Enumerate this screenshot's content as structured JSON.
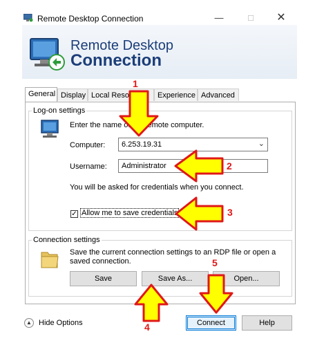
{
  "window": {
    "title": "Remote Desktop Connection"
  },
  "banner": {
    "line1": "Remote Desktop",
    "line2": "Connection"
  },
  "tabs": [
    {
      "label": "General"
    },
    {
      "label": "Display"
    },
    {
      "label": "Local Resources"
    },
    {
      "label": "Experience"
    },
    {
      "label": "Advanced"
    }
  ],
  "logon": {
    "group_label": "Log-on settings",
    "instruction": "Enter the name of the remote computer.",
    "computer_label": "Computer:",
    "computer_value": "6.253.19.31",
    "username_label": "Username:",
    "username_value": "Administrator",
    "credentials_note": "You will be asked for credentials when you connect.",
    "allow_save_label": "Allow me to save credentials"
  },
  "connection": {
    "group_label": "Connection settings",
    "description": "Save the current connection settings to an RDP file or open a saved connection.",
    "save_label": "Save",
    "save_as_label": "Save As...",
    "open_label": "Open..."
  },
  "footer": {
    "hide_options_label": "Hide Options",
    "connect_label": "Connect",
    "help_label": "Help"
  },
  "annotations": {
    "n1": "1",
    "n2": "2",
    "n3": "3",
    "n4": "4",
    "n5": "5"
  },
  "colors": {
    "arrow_fill": "#ffff00",
    "arrow_stroke": "#e01818",
    "title_blue": "#1c3e79"
  }
}
